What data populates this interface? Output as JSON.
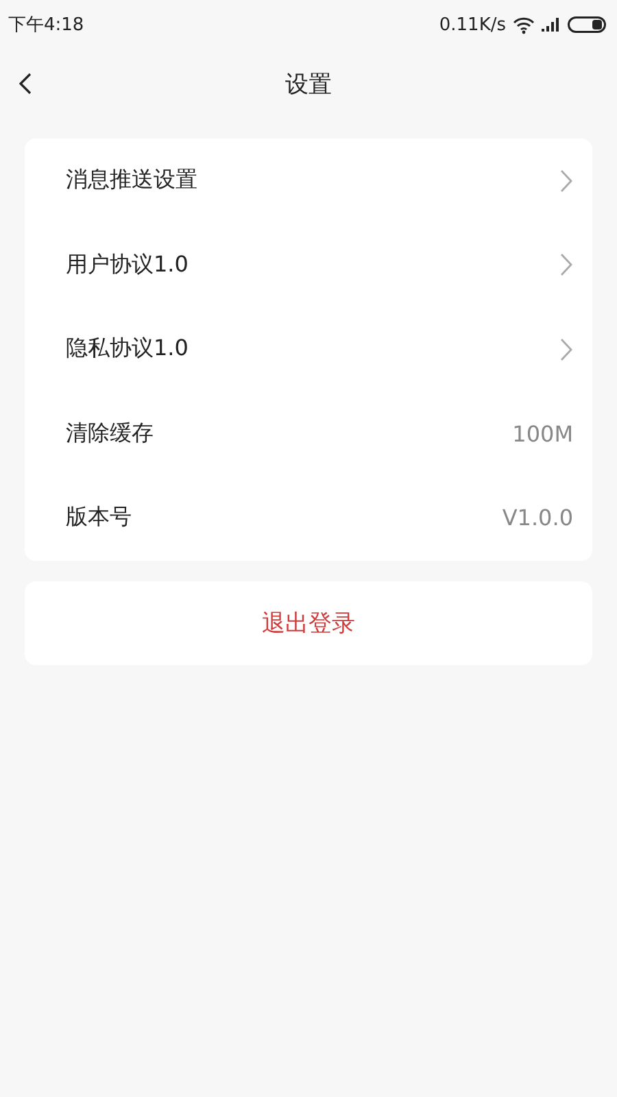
{
  "status_bar": {
    "time": "下午4:18",
    "network_speed": "0.11K/s"
  },
  "header": {
    "title": "设置"
  },
  "settings": [
    {
      "kind": "link",
      "label": "消息推送设置"
    },
    {
      "kind": "link",
      "label": "用户协议1.0"
    },
    {
      "kind": "link",
      "label": "隐私协议1.0"
    },
    {
      "kind": "value",
      "label": "清除缓存",
      "value": "100M"
    },
    {
      "kind": "value",
      "label": "版本号",
      "value": "V1.0.0"
    }
  ],
  "logout_button": "退出登录"
}
